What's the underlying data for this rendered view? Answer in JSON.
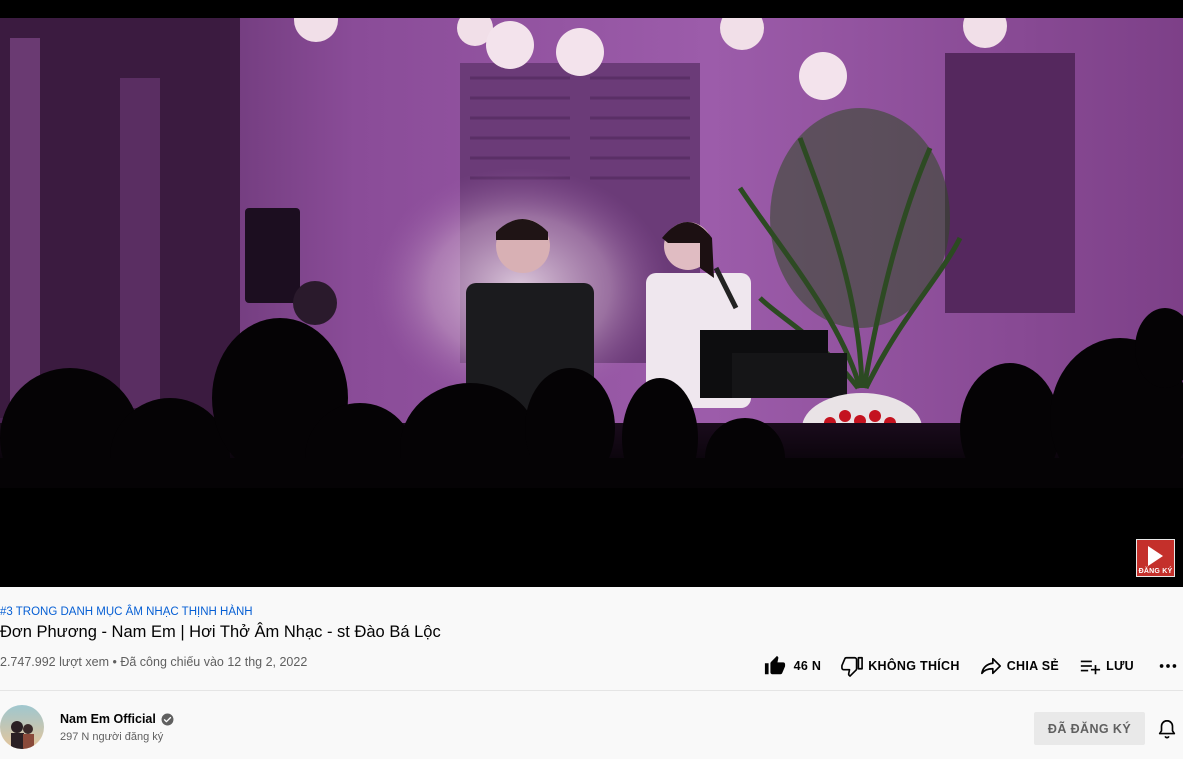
{
  "video": {
    "watermark_label": "ĐĂNG KÝ"
  },
  "info": {
    "trending": "#3 TRONG DANH MỤC ÂM NHẠC THỊNH HÀNH",
    "title": "Đơn Phương - Nam Em | Hơi Thở Âm Nhạc - st Đào Bá Lộc",
    "views": "2.747.992 lượt xem",
    "separator": "•",
    "premiered": "Đã công chiếu vào 12 thg 2, 2022"
  },
  "actions": {
    "like_count": "46 N",
    "dislike_label": "KHÔNG THÍCH",
    "share_label": "CHIA SẺ",
    "save_label": "LƯU",
    "icons": [
      "thumb-up-icon",
      "thumb-down-icon",
      "share-icon",
      "playlist-add-icon",
      "more-horizontal-icon"
    ]
  },
  "channel": {
    "name": "Nam Em Official",
    "subscribers": "297 N người đăng ký",
    "subscribed_label": "ĐÃ ĐĂNG KÝ",
    "icons": [
      "verified-icon",
      "bell-icon"
    ]
  },
  "colors": {
    "accent_link": "#065fd4",
    "watermark_red": "#c4302b",
    "stage_purple": "#7a3f8a",
    "background": "#f9f9f9"
  }
}
